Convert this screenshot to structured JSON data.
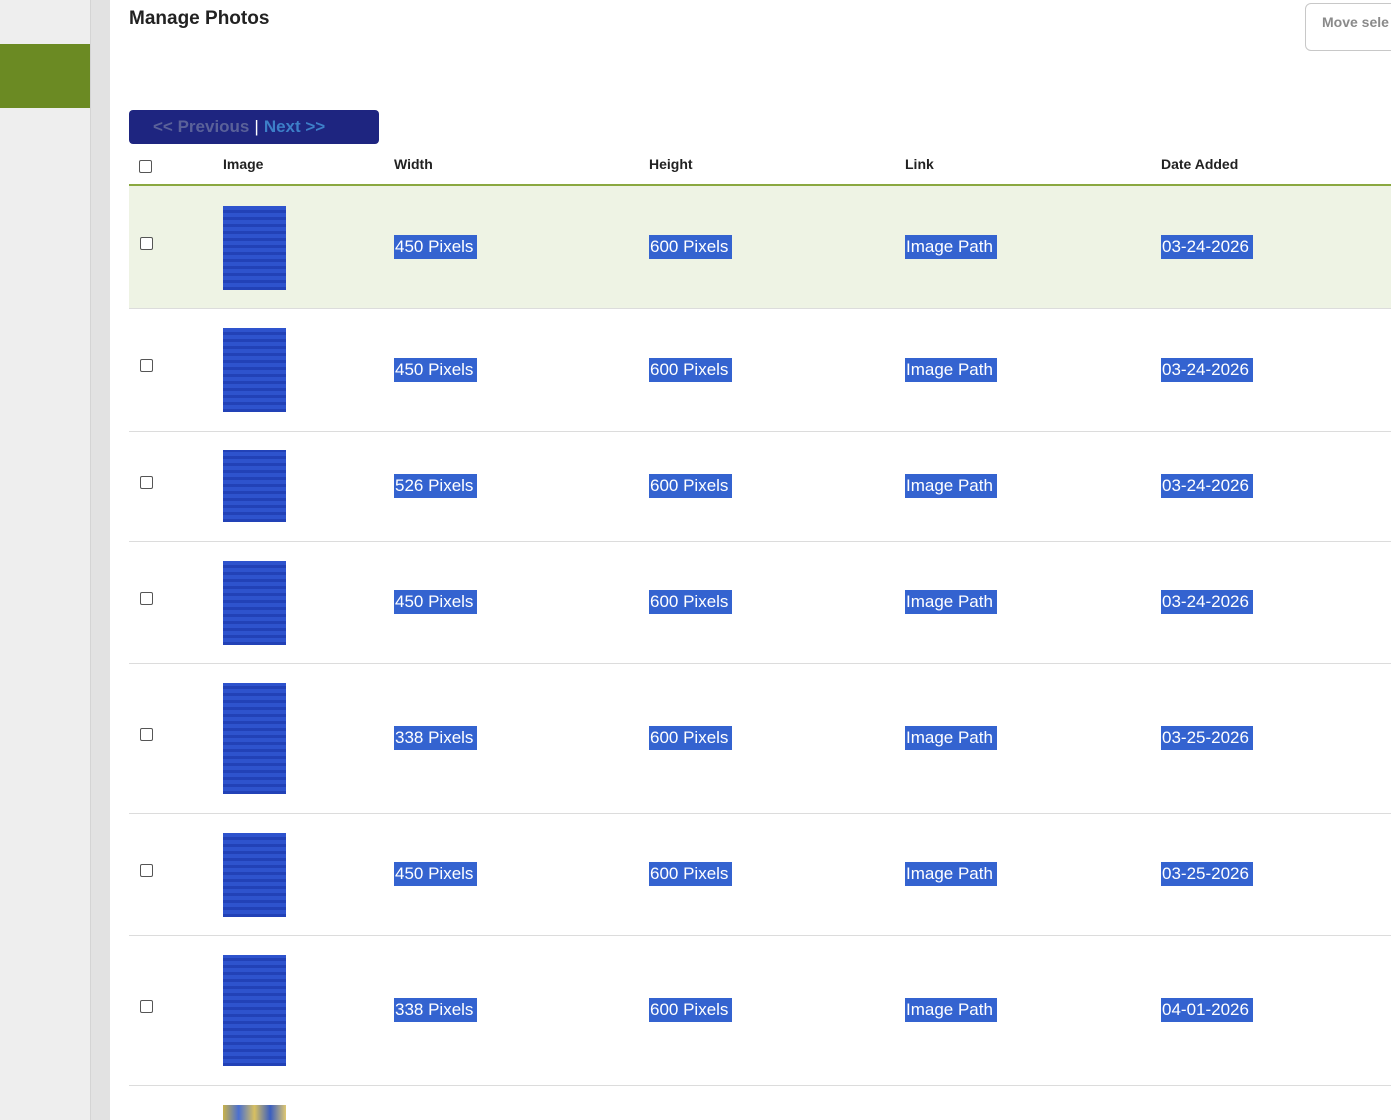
{
  "page": {
    "title": "Manage Photos"
  },
  "toolbar": {
    "move_label": "Move sele"
  },
  "pager": {
    "prev_label": "<<   Previous",
    "separator": "|",
    "next_label": "Next   >>"
  },
  "table": {
    "columns": [
      "Image",
      "Width",
      "Height",
      "Link",
      "Date Added"
    ],
    "rows": [
      {
        "width": "450 Pixels",
        "height": "600 Pixels",
        "link": "Image Path",
        "date": "03-24-2026"
      },
      {
        "width": "450 Pixels",
        "height": "600 Pixels",
        "link": "Image Path",
        "date": "03-24-2026"
      },
      {
        "width": "526 Pixels",
        "height": "600 Pixels",
        "link": "Image Path",
        "date": "03-24-2026"
      },
      {
        "width": "450 Pixels",
        "height": "600 Pixels",
        "link": "Image Path",
        "date": "03-24-2026"
      },
      {
        "width": "338 Pixels",
        "height": "600 Pixels",
        "link": "Image Path",
        "date": "03-25-2026"
      },
      {
        "width": "450 Pixels",
        "height": "600 Pixels",
        "link": "Image Path",
        "date": "03-25-2026"
      },
      {
        "width": "338 Pixels",
        "height": "600 Pixels",
        "link": "Image Path",
        "date": "04-01-2026"
      }
    ]
  },
  "colors": {
    "accent_green": "#6b8a23",
    "pager_bg": "#1e2580",
    "selection": "#3463d0"
  }
}
